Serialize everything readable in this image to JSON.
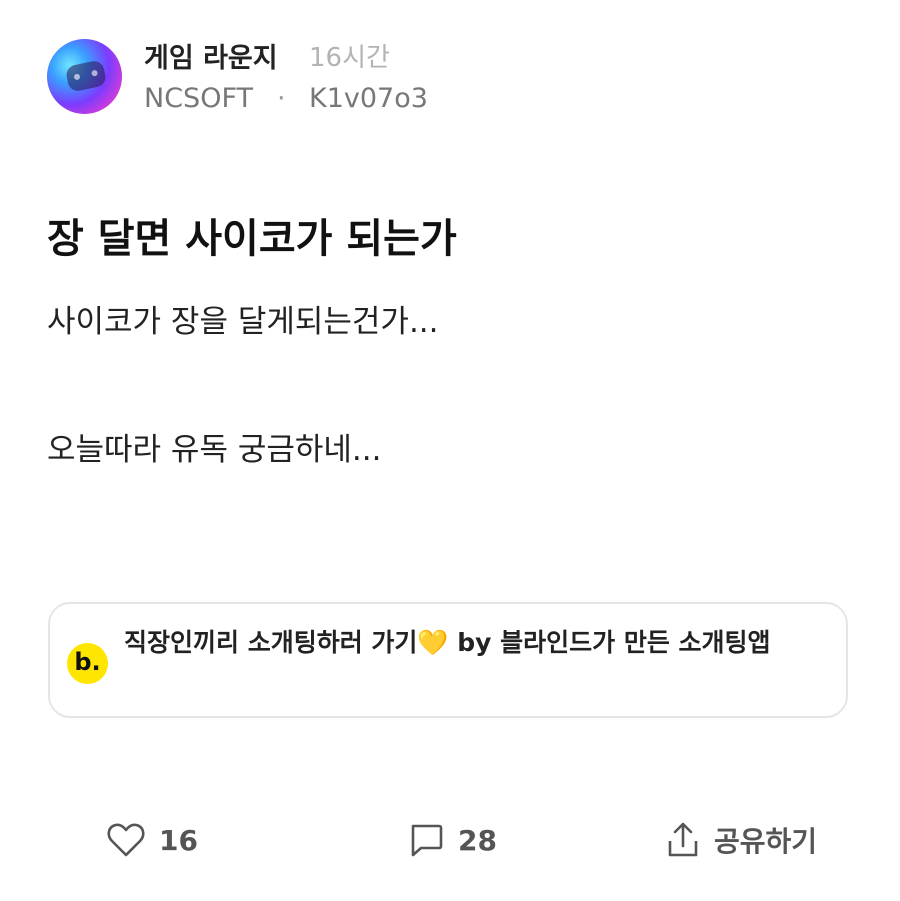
{
  "post": {
    "community": "게임 라운지",
    "time_ago": "16시간",
    "company": "NCSOFT",
    "separator": "·",
    "author": "K1v07o3",
    "title": "장 달면 사이코가 되는가",
    "body_lines": [
      "사이코가 장을 달게되는건가...",
      "오늘따라 유독 궁금하네..."
    ]
  },
  "ad": {
    "logo_text": "b.",
    "text": "직장인끼리 소개팅하러 가기💛 by 블라인드가 만든 소개팅앱",
    "logo_color": "#ffe600"
  },
  "actions": {
    "like_count": "16",
    "comment_count": "28",
    "share_label": "공유하기"
  },
  "icons": {
    "avatar": "game-controller-avatar",
    "like": "heart-icon",
    "comment": "comment-bubble-icon",
    "share": "share-icon"
  }
}
